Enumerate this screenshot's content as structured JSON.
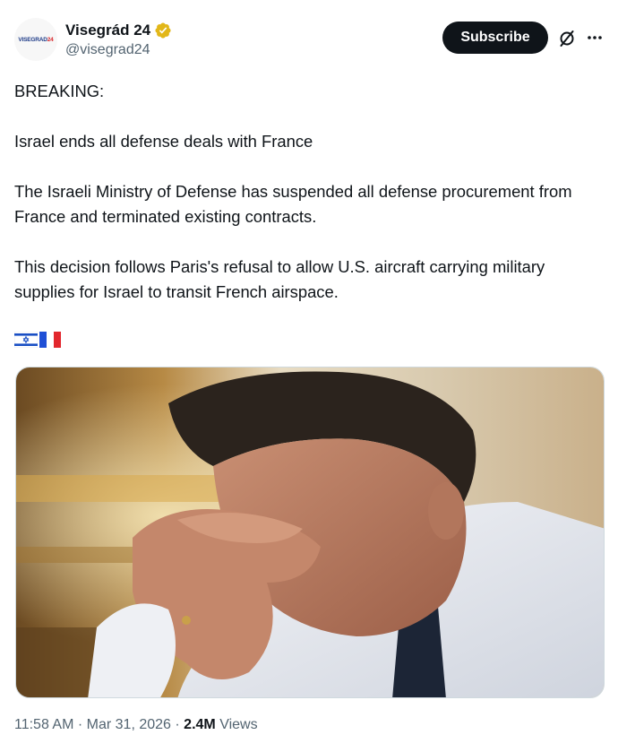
{
  "author": {
    "display_name": "Visegrád 24",
    "handle": "@visegrad24",
    "avatar_logo_part1": "VISEGRAD",
    "avatar_logo_part2": "24",
    "verified_badge": "gold-verified-icon",
    "badge_color": "#e2b719"
  },
  "header_actions": {
    "subscribe_label": "Subscribe",
    "grok_icon": "grok-icon",
    "more_icon": "more-icon"
  },
  "tweet": {
    "paragraphs": [
      "BREAKING:",
      "Israel ends all defense deals with France",
      "The Israeli Ministry of Defense has suspended all defense procurement from France and terminated existing contracts.",
      "This decision follows Paris's refusal to allow U.S. aircraft carrying military supplies for Israel to transit French airspace."
    ],
    "flags": [
      "israel-flag-icon",
      "france-flag-icon"
    ],
    "image": "photo-man-head-in-hands"
  },
  "meta": {
    "time": "11:58 AM",
    "separator": "·",
    "date": "Mar 31, 2026",
    "views_count": "2.4M",
    "views_label": "Views"
  },
  "colors": {
    "text_primary": "#0f1419",
    "text_secondary": "#536471",
    "button_bg": "#0f1419",
    "button_text": "#ffffff"
  }
}
